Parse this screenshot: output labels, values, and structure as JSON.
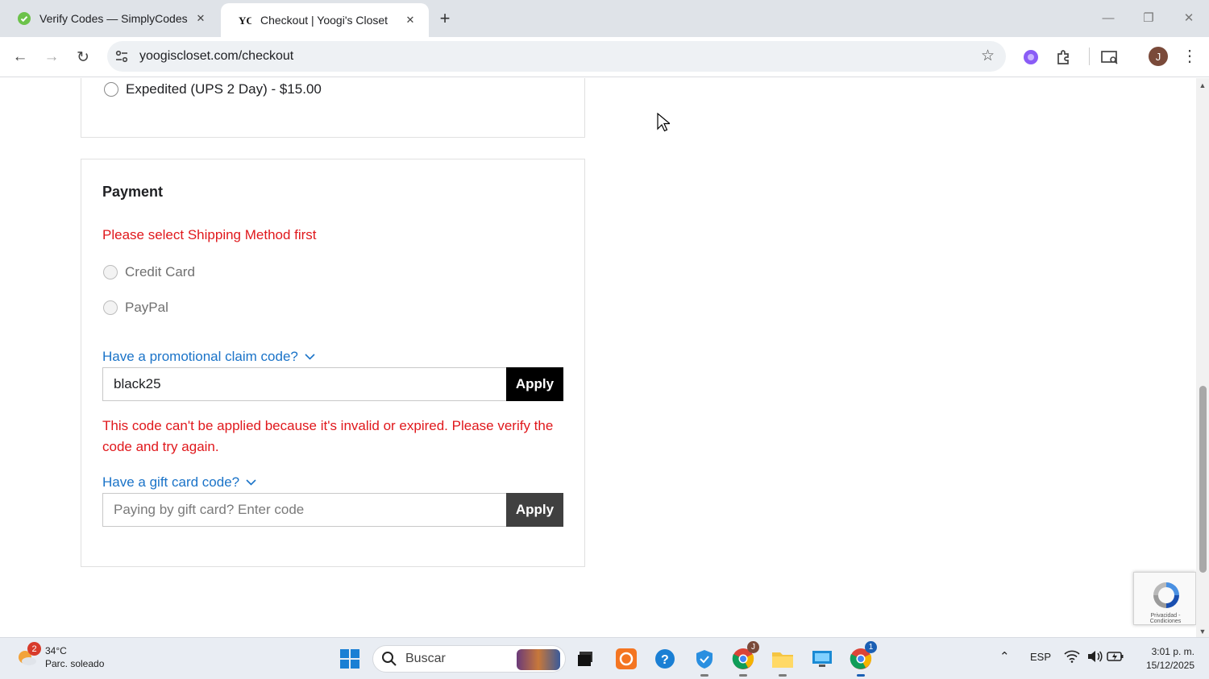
{
  "browser": {
    "tabs": [
      {
        "title": "Verify Codes — SimplyCodes",
        "active": false
      },
      {
        "title": "Checkout | Yoogi's Closet",
        "active": true
      }
    ],
    "url": "yoogiscloset.com/checkout",
    "profile_initial": "J"
  },
  "shipping": {
    "option_label": "Expedited (UPS 2 Day) - $15.00"
  },
  "payment": {
    "title": "Payment",
    "error": "Please select Shipping Method first",
    "methods": [
      "Credit Card",
      "PayPal"
    ],
    "promo": {
      "toggle_label": "Have a promotional claim code?",
      "value": "black25",
      "apply_label": "Apply",
      "error": "This code can't be applied because it's invalid or expired. Please verify the code and try again."
    },
    "gift": {
      "toggle_label": "Have a gift card code?",
      "placeholder": "Paying by gift card? Enter code",
      "apply_label": "Apply"
    }
  },
  "recaptcha": {
    "footer": "Privacidad - Condiciones"
  },
  "taskbar": {
    "weather_temp": "34°C",
    "weather_desc": "Parc. soleado",
    "weather_badge": "2",
    "search_label": "Buscar",
    "chrome_badge": "1",
    "language": "ESP",
    "time": "3:01 p. m.",
    "date": "15/12/2025"
  }
}
